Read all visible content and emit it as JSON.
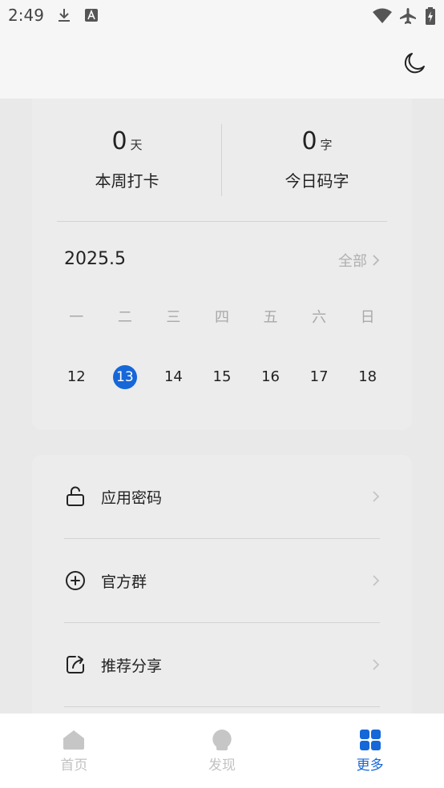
{
  "status_bar": {
    "time": "2:49"
  },
  "stats": {
    "week": {
      "value": "0",
      "unit": "天",
      "label": "本周打卡"
    },
    "today": {
      "value": "0",
      "unit": "字",
      "label": "今日码字"
    }
  },
  "calendar": {
    "month": "2025.5",
    "all_label": "全部",
    "weekdays": [
      "一",
      "二",
      "三",
      "四",
      "五",
      "六",
      "日"
    ],
    "dates": [
      "12",
      "13",
      "14",
      "15",
      "16",
      "17",
      "18"
    ],
    "today_index": 1
  },
  "menu": {
    "items": [
      {
        "label": "应用密码",
        "icon": "unlock-icon"
      },
      {
        "label": "官方群",
        "icon": "plus-circle-icon"
      },
      {
        "label": "推荐分享",
        "icon": "share-icon"
      }
    ]
  },
  "nav": {
    "tabs": [
      {
        "label": "首页",
        "icon": "home-icon"
      },
      {
        "label": "发现",
        "icon": "bulb-icon"
      },
      {
        "label": "更多",
        "icon": "grid-icon",
        "active": true
      }
    ]
  },
  "colors": {
    "accent": "#1667d8",
    "inactive": "#c2c2c2"
  }
}
